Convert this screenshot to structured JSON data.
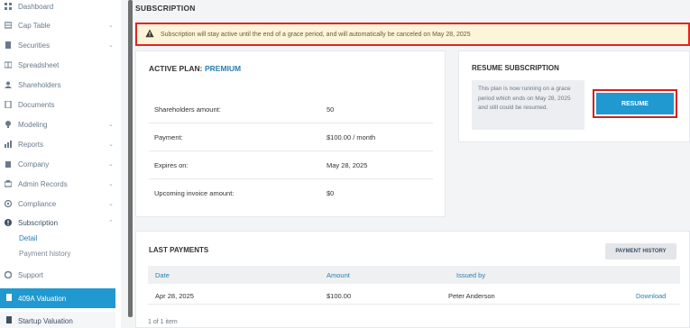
{
  "sidebar": {
    "items": [
      {
        "label": "Dashboard",
        "icon": "dashboard-icon",
        "chevron": ""
      },
      {
        "label": "Cap Table",
        "icon": "cap-table-icon",
        "chevron": "⌄"
      },
      {
        "label": "Securities",
        "icon": "securities-icon",
        "chevron": "⌄"
      },
      {
        "label": "Spreadsheet",
        "icon": "spreadsheet-icon",
        "chevron": ""
      },
      {
        "label": "Shareholders",
        "icon": "shareholders-icon",
        "chevron": ""
      },
      {
        "label": "Documents",
        "icon": "documents-icon",
        "chevron": ""
      },
      {
        "label": "Modeling",
        "icon": "modeling-icon",
        "chevron": "⌄"
      },
      {
        "label": "Reports",
        "icon": "reports-icon",
        "chevron": "⌄"
      },
      {
        "label": "Company",
        "icon": "company-icon",
        "chevron": "⌄"
      },
      {
        "label": "Admin Records",
        "icon": "admin-records-icon",
        "chevron": "⌄"
      },
      {
        "label": "Compliance",
        "icon": "compliance-icon",
        "chevron": "⌄"
      },
      {
        "label": "Subscription",
        "icon": "subscription-icon",
        "chevron": "⌃"
      }
    ],
    "sub_items": [
      {
        "label": "Detail"
      },
      {
        "label": "Payment history"
      }
    ],
    "support": "Support",
    "valuation_409a": "409A Valuation",
    "startup_valuation": "Startup Valuation"
  },
  "page": {
    "title": "SUBSCRIPTION",
    "alert": "Subscription will stay active until the end of a grace period, and will automatically be canceled on May 28, 2025"
  },
  "plan": {
    "heading": "ACTIVE PLAN:",
    "name": "PREMIUM",
    "rows": [
      {
        "key": "Shareholders amount:",
        "value": "50"
      },
      {
        "key": "Payment:",
        "value": "$100.00 / month"
      },
      {
        "key": "Expires on:",
        "value": "May 28, 2025"
      },
      {
        "key": "Upcoming invoice amount:",
        "value": "$0"
      }
    ]
  },
  "resume": {
    "heading": "RESUME SUBSCRIPTION",
    "note": "This plan is now running on a grace period which ends on May 28, 2025 and still could be resumed.",
    "button": "RESUME"
  },
  "payments": {
    "heading": "LAST PAYMENTS",
    "history_button": "PAYMENT HISTORY",
    "columns": [
      "Date",
      "Amount",
      "Issued by"
    ],
    "rows": [
      {
        "date": "Apr 28, 2025",
        "amount": "$100.00",
        "issued_by": "Peter Anderson",
        "action": "Download"
      }
    ],
    "pager": "1 of 1 item"
  },
  "colors": {
    "accent": "#1f99cf",
    "link": "#2a7fb0",
    "alert_bg": "#fcf5d9",
    "highlight_border": "#e02424"
  }
}
